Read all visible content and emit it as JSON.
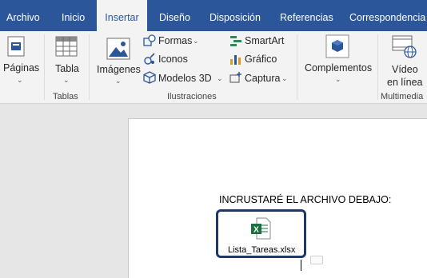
{
  "tabs": [
    {
      "label": "Archivo",
      "active": false
    },
    {
      "label": "Inicio",
      "active": false
    },
    {
      "label": "Insertar",
      "active": true
    },
    {
      "label": "Diseño",
      "active": false
    },
    {
      "label": "Disposición",
      "active": false
    },
    {
      "label": "Referencias",
      "active": false
    },
    {
      "label": "Correspondencia",
      "active": false
    }
  ],
  "ribbon": {
    "pages": {
      "label": "Páginas"
    },
    "tables": {
      "table_label": "Tabla",
      "group_label": "Tablas"
    },
    "illustrations": {
      "images_label": "Imágenes",
      "shapes_label": "Formas",
      "icons_label": "Iconos",
      "models3d_label": "Modelos 3D",
      "smartart_label": "SmartArt",
      "chart_label": "Gráfico",
      "screenshot_label": "Captura",
      "group_label": "Ilustraciones"
    },
    "addins": {
      "label": "Complementos"
    },
    "media": {
      "video_label_line1": "Vídeo",
      "video_label_line2": "en línea",
      "group_label": "Multimedia"
    }
  },
  "document": {
    "heading": "INCRUSTARÉ EL ARCHIVO DEBAJO:",
    "embedded_file": "Lista_Tareas.xlsx"
  },
  "colors": {
    "tabbar": "#2b579a",
    "ribbon": "#f3f3f3",
    "embed_border": "#1f3864",
    "excel_green": "#1d6f42"
  }
}
